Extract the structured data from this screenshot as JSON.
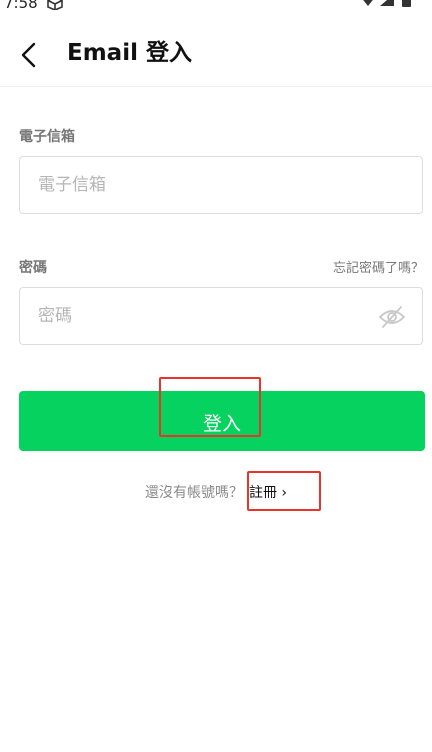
{
  "status_bar": {
    "time": "7:58"
  },
  "header": {
    "title": "Email 登入"
  },
  "form": {
    "email_label": "電子信箱",
    "email_placeholder": "電子信箱",
    "password_label": "密碼",
    "forgot_link": "忘記密碼了嗎？",
    "password_placeholder": "密碼",
    "login_button": "登入"
  },
  "footer": {
    "signup_prompt": "還沒有帳號嗎？",
    "signup_link": "註冊 ›"
  },
  "colors": {
    "accent": "#06d35f",
    "annotation": "#e8342a"
  }
}
